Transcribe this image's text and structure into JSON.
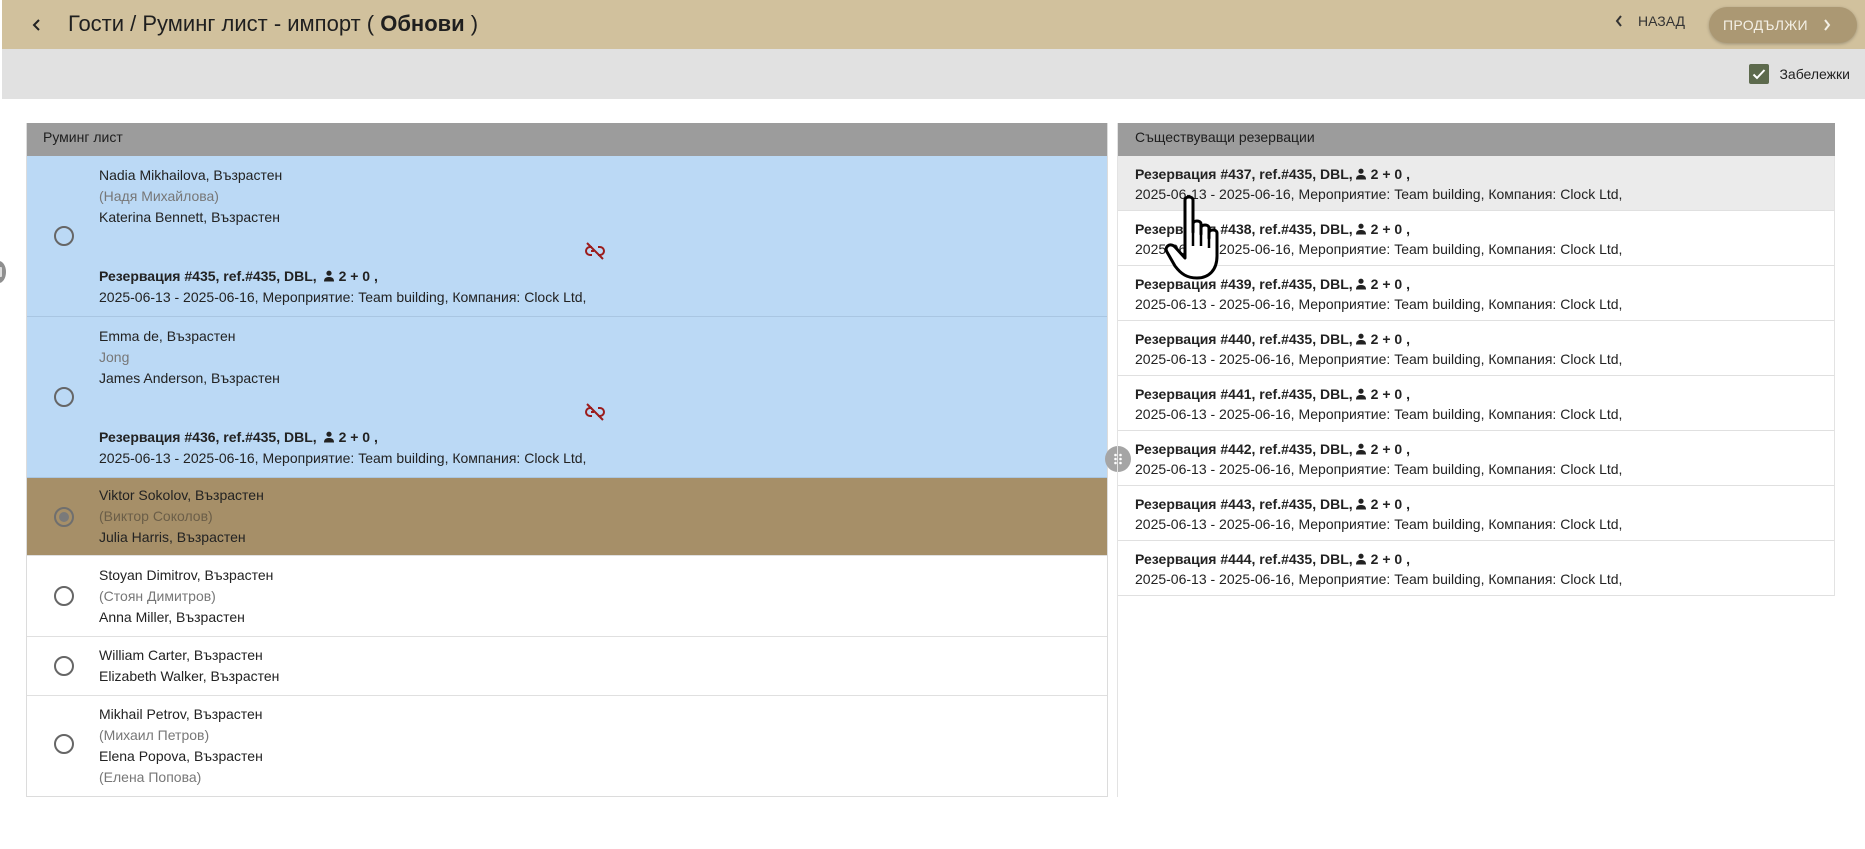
{
  "header": {
    "title_prefix": "Гости / Руминг лист - импорт (",
    "title_bold": " Обнови ",
    "title_suffix": ")",
    "back_label": "НАЗАД",
    "continue_label": "ПРОДЪЛЖИ",
    "bar_color": "#d1c19d",
    "button_color": "#ab9873"
  },
  "subbar": {
    "notes_label": "Забележки",
    "notes_checked": true
  },
  "rooming_list": {
    "header": "Руминг лист",
    "rows": [
      {
        "state": "linked",
        "guest1": "Nadia Mikhailova, Възрастен",
        "guest1_alt": "(Надя Михайлова)",
        "guest2": "Katerina Bennett, Възрастен",
        "reservation_title": "Резервация #435, ref.#435, DBL,",
        "reservation_pax": "2 + 0 ,",
        "reservation_details": "2025-06-13 - 2025-06-16, Мероприятие: Team building, Компания: Clock Ltd,"
      },
      {
        "state": "linked",
        "guest1": "Emma de, Възрастен",
        "guest1_alt": "Jong",
        "guest2": "James Anderson, Възрастен",
        "reservation_title": "Резервация #436, ref.#435, DBL,",
        "reservation_pax": "2 + 0 ,",
        "reservation_details": "2025-06-13 - 2025-06-16, Мероприятие: Team building, Компания: Clock Ltd,"
      },
      {
        "state": "selected",
        "guest1": "Viktor Sokolov, Възрастен",
        "guest1_alt": "(Виктор Соколов)",
        "guest2": "Julia Harris, Възрастен"
      },
      {
        "state": "normal",
        "guest1": "Stoyan Dimitrov, Възрастен",
        "guest1_alt": "(Стоян Димитров)",
        "guest2": "Anna Miller, Възрастен"
      },
      {
        "state": "normal",
        "guest1": "William Carter, Възрастен",
        "guest2": "Elizabeth Walker, Възрастен"
      },
      {
        "state": "normal",
        "guest1": "Mikhail Petrov, Възрастен",
        "guest1_alt": "(Михаил Петров)",
        "guest2": "Elena Popova, Възрастен",
        "guest2_alt": "(Елена Попова)"
      }
    ]
  },
  "existing_reservations": {
    "header": "Съществуващи резервации",
    "items": [
      {
        "title": "Резервация #437, ref.#435, DBL,",
        "pax": "2 + 0 ,",
        "details": "2025-06-13 - 2025-06-16, Мероприятие: Team building, Компания: Clock Ltd,"
      },
      {
        "title": "Резервация #438, ref.#435, DBL,",
        "pax": "2 + 0 ,",
        "details": "2025-06-13 - 2025-06-16, Мероприятие: Team building, Компания: Clock Ltd,"
      },
      {
        "title": "Резервация #439, ref.#435, DBL,",
        "pax": "2 + 0 ,",
        "details": "2025-06-13 - 2025-06-16, Мероприятие: Team building, Компания: Clock Ltd,"
      },
      {
        "title": "Резервация #440, ref.#435, DBL,",
        "pax": "2 + 0 ,",
        "details": "2025-06-13 - 2025-06-16, Мероприятие: Team building, Компания: Clock Ltd,"
      },
      {
        "title": "Резервация #441, ref.#435, DBL,",
        "pax": "2 + 0 ,",
        "details": "2025-06-13 - 2025-06-16, Мероприятие: Team building, Компания: Clock Ltd,"
      },
      {
        "title": "Резервация #442, ref.#435, DBL,",
        "pax": "2 + 0 ,",
        "details": "2025-06-13 - 2025-06-16, Мероприятие: Team building, Компания: Clock Ltd,"
      },
      {
        "title": "Резервация #443, ref.#435, DBL,",
        "pax": "2 + 0 ,",
        "details": "2025-06-13 - 2025-06-16, Мероприятие: Team building, Компания: Clock Ltd,"
      },
      {
        "title": "Резервация #444, ref.#435, DBL,",
        "pax": "2 + 0 ,",
        "details": "2025-06-13 - 2025-06-16, Мероприятие: Team building, Компания: Clock Ltd,"
      }
    ]
  },
  "colors": {
    "linked_row": "#bbd9f5",
    "selected_row": "#a68f68",
    "unlink_icon": "#9b1c1c"
  },
  "icons": {
    "back": "chevron-left-icon",
    "continue": "chevron-right-icon",
    "unlink": "link-off-icon",
    "person": "person-icon",
    "splitter": "drag-handle-icon",
    "cursor": "hand-pointer-cursor"
  }
}
